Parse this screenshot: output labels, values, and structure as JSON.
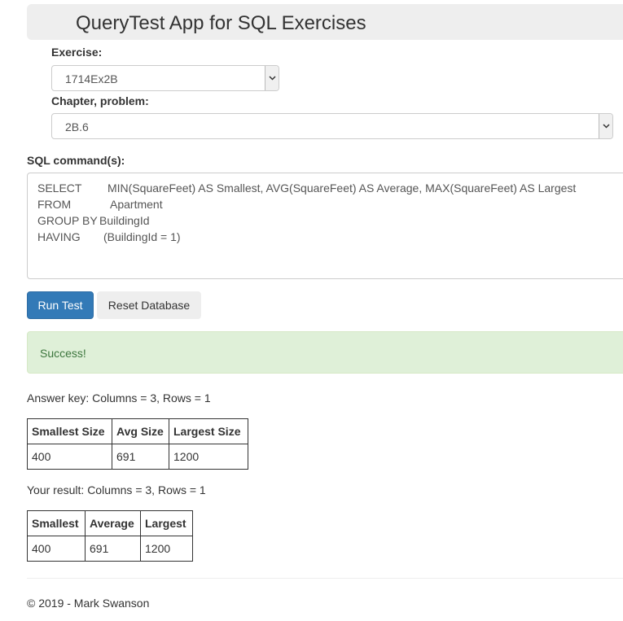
{
  "header": {
    "title": "QueryTest App for SQL Exercises"
  },
  "exercise": {
    "label": "Exercise:",
    "selected": "1714Ex2B"
  },
  "chapter": {
    "label": "Chapter, problem:",
    "selected": "2B.6"
  },
  "sql": {
    "label": "SQL command(s):",
    "lines": [
      {
        "keyword": "SELECT",
        "rest": "MIN(SquareFeet) AS Smallest, AVG(SquareFeet) AS Average, MAX(SquareFeet) AS Largest"
      },
      {
        "keyword": "FROM",
        "rest": "Apartment"
      },
      {
        "keyword": "GROUP BY",
        "rest": "BuildingId"
      },
      {
        "keyword": "HAVING",
        "rest": "(BuildingId = 1)"
      }
    ]
  },
  "buttons": {
    "run": "Run Test",
    "reset": "Reset Database"
  },
  "alert": {
    "text": "Success!"
  },
  "answer_key": {
    "summary": "Answer key: Columns = 3, Rows = 1",
    "columns": [
      "Smallest Size",
      "Avg Size",
      "Largest Size"
    ],
    "rows": [
      [
        "400",
        "691",
        "1200"
      ]
    ]
  },
  "result": {
    "summary": "Your result: Columns = 3, Rows = 1",
    "columns": [
      "Smallest",
      "Average",
      "Largest"
    ],
    "rows": [
      [
        "400",
        "691",
        "1200"
      ]
    ]
  },
  "footer": {
    "text": "© 2019 - Mark Swanson"
  },
  "colors": {
    "primary": "#337ab7",
    "success_bg": "#dff0d8",
    "success_text": "#3c763d",
    "header_bg": "#eeeeee"
  },
  "icons": {
    "select_arrow": "chevron-down-icon"
  }
}
